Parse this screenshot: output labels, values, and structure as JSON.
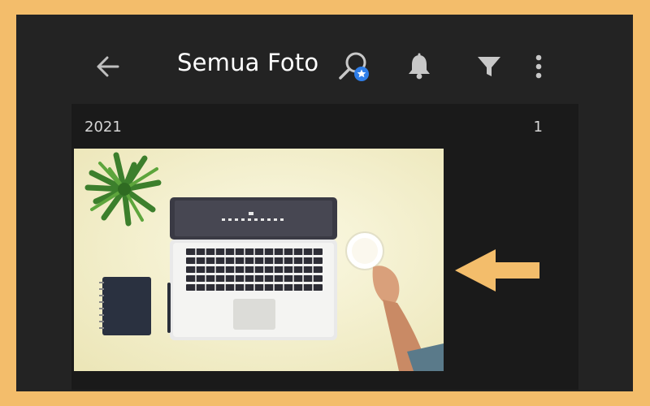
{
  "header": {
    "title": "Semua Foto",
    "icons": [
      "back-arrow-icon",
      "smart-search-icon",
      "bell-icon",
      "filter-icon",
      "more-vertical-icon"
    ]
  },
  "section": {
    "year": "2021",
    "count": "1"
  },
  "colors": {
    "frame": "#f3bd6b",
    "background": "#232323",
    "panel": "#1a1a1a",
    "search_badge": "#2f7ee8",
    "annotation_arrow": "#f3bd6b"
  }
}
